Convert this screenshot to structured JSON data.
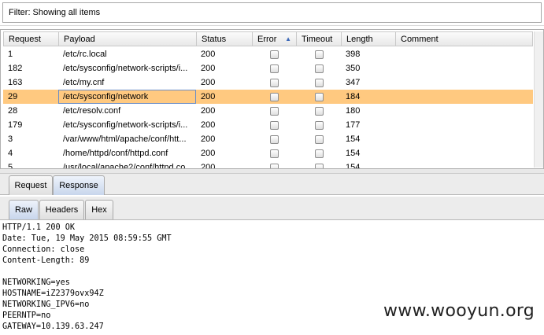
{
  "filter": {
    "text": "Filter: Showing all items"
  },
  "table": {
    "headers": {
      "request": "Request",
      "payload": "Payload",
      "status": "Status",
      "error": "Error",
      "timeout": "Timeout",
      "length": "Length",
      "comment": "Comment"
    },
    "sort_column": "Error",
    "rows": [
      {
        "request": "1",
        "payload": "/etc/rc.local",
        "status": "200",
        "error": false,
        "timeout": false,
        "length": "398",
        "comment": ""
      },
      {
        "request": "182",
        "payload": "/etc/sysconfig/network-scripts/i...",
        "status": "200",
        "error": false,
        "timeout": false,
        "length": "350",
        "comment": ""
      },
      {
        "request": "163",
        "payload": "/etc/my.cnf",
        "status": "200",
        "error": false,
        "timeout": false,
        "length": "347",
        "comment": ""
      },
      {
        "request": "29",
        "payload": "/etc/sysconfig/network",
        "status": "200",
        "error": false,
        "timeout": false,
        "length": "184",
        "comment": "",
        "selected": true
      },
      {
        "request": "28",
        "payload": "/etc/resolv.conf",
        "status": "200",
        "error": false,
        "timeout": false,
        "length": "180",
        "comment": ""
      },
      {
        "request": "179",
        "payload": "/etc/sysconfig/network-scripts/i...",
        "status": "200",
        "error": false,
        "timeout": false,
        "length": "177",
        "comment": ""
      },
      {
        "request": "3",
        "payload": "/var/www/html/apache/conf/htt...",
        "status": "200",
        "error": false,
        "timeout": false,
        "length": "154",
        "comment": ""
      },
      {
        "request": "4",
        "payload": "/home/httpd/conf/httpd.conf",
        "status": "200",
        "error": false,
        "timeout": false,
        "length": "154",
        "comment": ""
      },
      {
        "request": "5",
        "payload": "/usr/local/apache2/conf/httpd.co...",
        "status": "200",
        "error": false,
        "timeout": false,
        "length": "154",
        "comment": ""
      }
    ]
  },
  "tabs": {
    "top": [
      "Request",
      "Response"
    ],
    "top_active": "Response",
    "sub": [
      "Raw",
      "Headers",
      "Hex"
    ],
    "sub_active": "Raw"
  },
  "response": {
    "lines": [
      "HTTP/1.1 200 OK",
      "Date: Tue, 19 May 2015 08:59:55 GMT",
      "Connection: close",
      "Content-Length: 89",
      "",
      "NETWORKING=yes",
      "HOSTNAME=iZ2379ovx94Z",
      "NETWORKING_IPV6=no",
      "PEERNTP=no",
      "GATEWAY=10.139.63.247"
    ]
  },
  "watermark": "www.wooyun.org",
  "colors": {
    "selected_row": "#ffc980",
    "sort_arrow": "#3b68b8"
  }
}
